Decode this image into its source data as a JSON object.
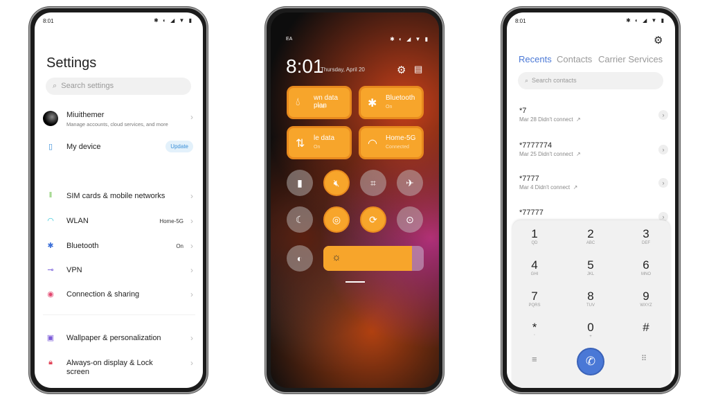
{
  "settings": {
    "status_time": "8:01",
    "status_icons": "✱ ◐ ◢ ▼ ▮",
    "title": "Settings",
    "search_placeholder": "Search settings",
    "account": {
      "name": "Miuithemer",
      "sub": "Manage accounts, cloud services, and more"
    },
    "device": {
      "label": "My device",
      "badge": "Update"
    },
    "items": [
      {
        "label": "SIM cards & mobile networks",
        "value": "",
        "icon": "sim-icon",
        "color": "#6cc04a"
      },
      {
        "label": "WLAN",
        "value": "Home-5G",
        "icon": "wifi-icon",
        "color": "#2ec4d6"
      },
      {
        "label": "Bluetooth",
        "value": "On",
        "icon": "bluetooth-icon",
        "color": "#3b6fd8"
      },
      {
        "label": "VPN",
        "value": "",
        "icon": "key-icon",
        "color": "#6b4fd8"
      },
      {
        "label": "Connection & sharing",
        "value": "",
        "icon": "share-icon",
        "color": "#e2466e"
      },
      {
        "label": "Wallpaper & personalization",
        "value": "",
        "icon": "wallpaper-icon",
        "color": "#7b5ad8"
      },
      {
        "label": "Always-on display & Lock screen",
        "value": "",
        "icon": "lock-icon",
        "color": "#e2465a"
      }
    ]
  },
  "control": {
    "carrier": "EA",
    "time": "8:01",
    "date": "Thursday, April 20",
    "tiles": [
      {
        "title": "wn data plan",
        "sub": "-- MB",
        "icon": "drop-icon"
      },
      {
        "title": "Bluetooth",
        "sub": "On",
        "icon": "bluetooth-icon"
      },
      {
        "title": "le data",
        "sub": "On",
        "icon": "mobile-data-icon"
      },
      {
        "title": "Home-5G",
        "sub": "Connected",
        "icon": "wifi-icon"
      }
    ],
    "toggles": [
      {
        "icon": "flashlight-icon",
        "on": false
      },
      {
        "icon": "mute-icon",
        "on": true
      },
      {
        "icon": "crop-icon",
        "on": false
      },
      {
        "icon": "airplane-icon",
        "on": false
      },
      {
        "icon": "moon-icon",
        "on": false
      },
      {
        "icon": "location-icon",
        "on": true
      },
      {
        "icon": "rotate-icon",
        "on": true
      },
      {
        "icon": "record-icon",
        "on": false
      },
      {
        "icon": "auto-brightness-icon",
        "on": false
      }
    ],
    "brightness_percent": 88,
    "accent": "#f7a52b"
  },
  "phone": {
    "status_time": "8:01",
    "tabs": [
      "Recents",
      "Contacts",
      "Carrier Services"
    ],
    "search_placeholder": "Search contacts",
    "recents": [
      {
        "number": "*7",
        "sub": "Mar 28 Didn't connect"
      },
      {
        "number": "*7777774",
        "sub": "Mar 25 Didn't connect"
      },
      {
        "number": "*7777",
        "sub": "Mar 4 Didn't connect"
      },
      {
        "number": "*77777",
        "sub": ""
      }
    ],
    "keys": [
      [
        "1",
        "QD"
      ],
      [
        "2",
        "ABC"
      ],
      [
        "3",
        "DEF"
      ],
      [
        "4",
        "GHI"
      ],
      [
        "5",
        "JKL"
      ],
      [
        "6",
        "MNO"
      ],
      [
        "7",
        "PQRS"
      ],
      [
        "8",
        "TUV"
      ],
      [
        "9",
        "WXYZ"
      ],
      [
        "*",
        "'"
      ],
      [
        "0",
        "+"
      ],
      [
        "#",
        ""
      ]
    ],
    "accent": "#4a78d6"
  }
}
